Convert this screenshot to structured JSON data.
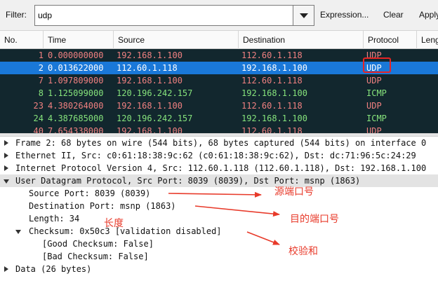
{
  "toolbar": {
    "filter_label": "Filter:",
    "filter_value": "udp",
    "expression_label": "Expression...",
    "clear_label": "Clear",
    "apply_label": "Apply"
  },
  "columns": {
    "no": "No.",
    "time": "Time",
    "source": "Source",
    "destination": "Destination",
    "protocol": "Protocol",
    "length": "Length"
  },
  "packets": [
    {
      "no": "1",
      "time": "0.000000000",
      "source": "192.168.1.100",
      "destination": "112.60.1.118",
      "protocol": "UDP"
    },
    {
      "no": "2",
      "time": "0.013622000",
      "source": "112.60.1.118",
      "destination": "192.168.1.100",
      "protocol": "UDP"
    },
    {
      "no": "7",
      "time": "1.097809000",
      "source": "192.168.1.100",
      "destination": "112.60.1.118",
      "protocol": "UDP"
    },
    {
      "no": "8",
      "time": "1.125099000",
      "source": "120.196.242.157",
      "destination": "192.168.1.100",
      "protocol": "ICMP"
    },
    {
      "no": "23",
      "time": "4.380264000",
      "source": "192.168.1.100",
      "destination": "112.60.1.118",
      "protocol": "UDP"
    },
    {
      "no": "24",
      "time": "4.387685000",
      "source": "120.196.242.157",
      "destination": "192.168.1.100",
      "protocol": "ICMP"
    },
    {
      "no": "40",
      "time": "7.654338000",
      "source": "192.168.1.100",
      "destination": "112.60.1.118",
      "protocol": "UDP"
    }
  ],
  "selected_packet": "2",
  "details": {
    "frame": "Frame 2: 68 bytes on wire (544 bits), 68 bytes captured (544 bits) on interface 0",
    "ethernet": "Ethernet II, Src: c0:61:18:38:9c:62 (c0:61:18:38:9c:62), Dst: dc:71:96:5c:24:29",
    "ip": "Internet Protocol Version 4, Src: 112.60.1.118 (112.60.1.118), Dst: 192.168.1.100",
    "udp": "User Datagram Protocol, Src Port: 8039 (8039), Dst Port: msnp (1863)",
    "src_port": "Source Port: 8039 (8039)",
    "dst_port": "Destination Port: msnp (1863)",
    "length": "Length: 34",
    "checksum": "Checksum: 0x50c3 [validation disabled]",
    "good_checksum": "[Good Checksum: False]",
    "bad_checksum": "[Bad Checksum: False]",
    "data": "Data (26 bytes)"
  },
  "annotations": {
    "src_port": "源端口号",
    "dst_port": "目的端口号",
    "length": "长度",
    "checksum": "校验和"
  },
  "colors": {
    "udp_text": "#f08080",
    "icmp_text": "#86e37c",
    "row_background": "#12272e",
    "selected_row": "#1a78d8",
    "annotation": "#e83a2a"
  }
}
